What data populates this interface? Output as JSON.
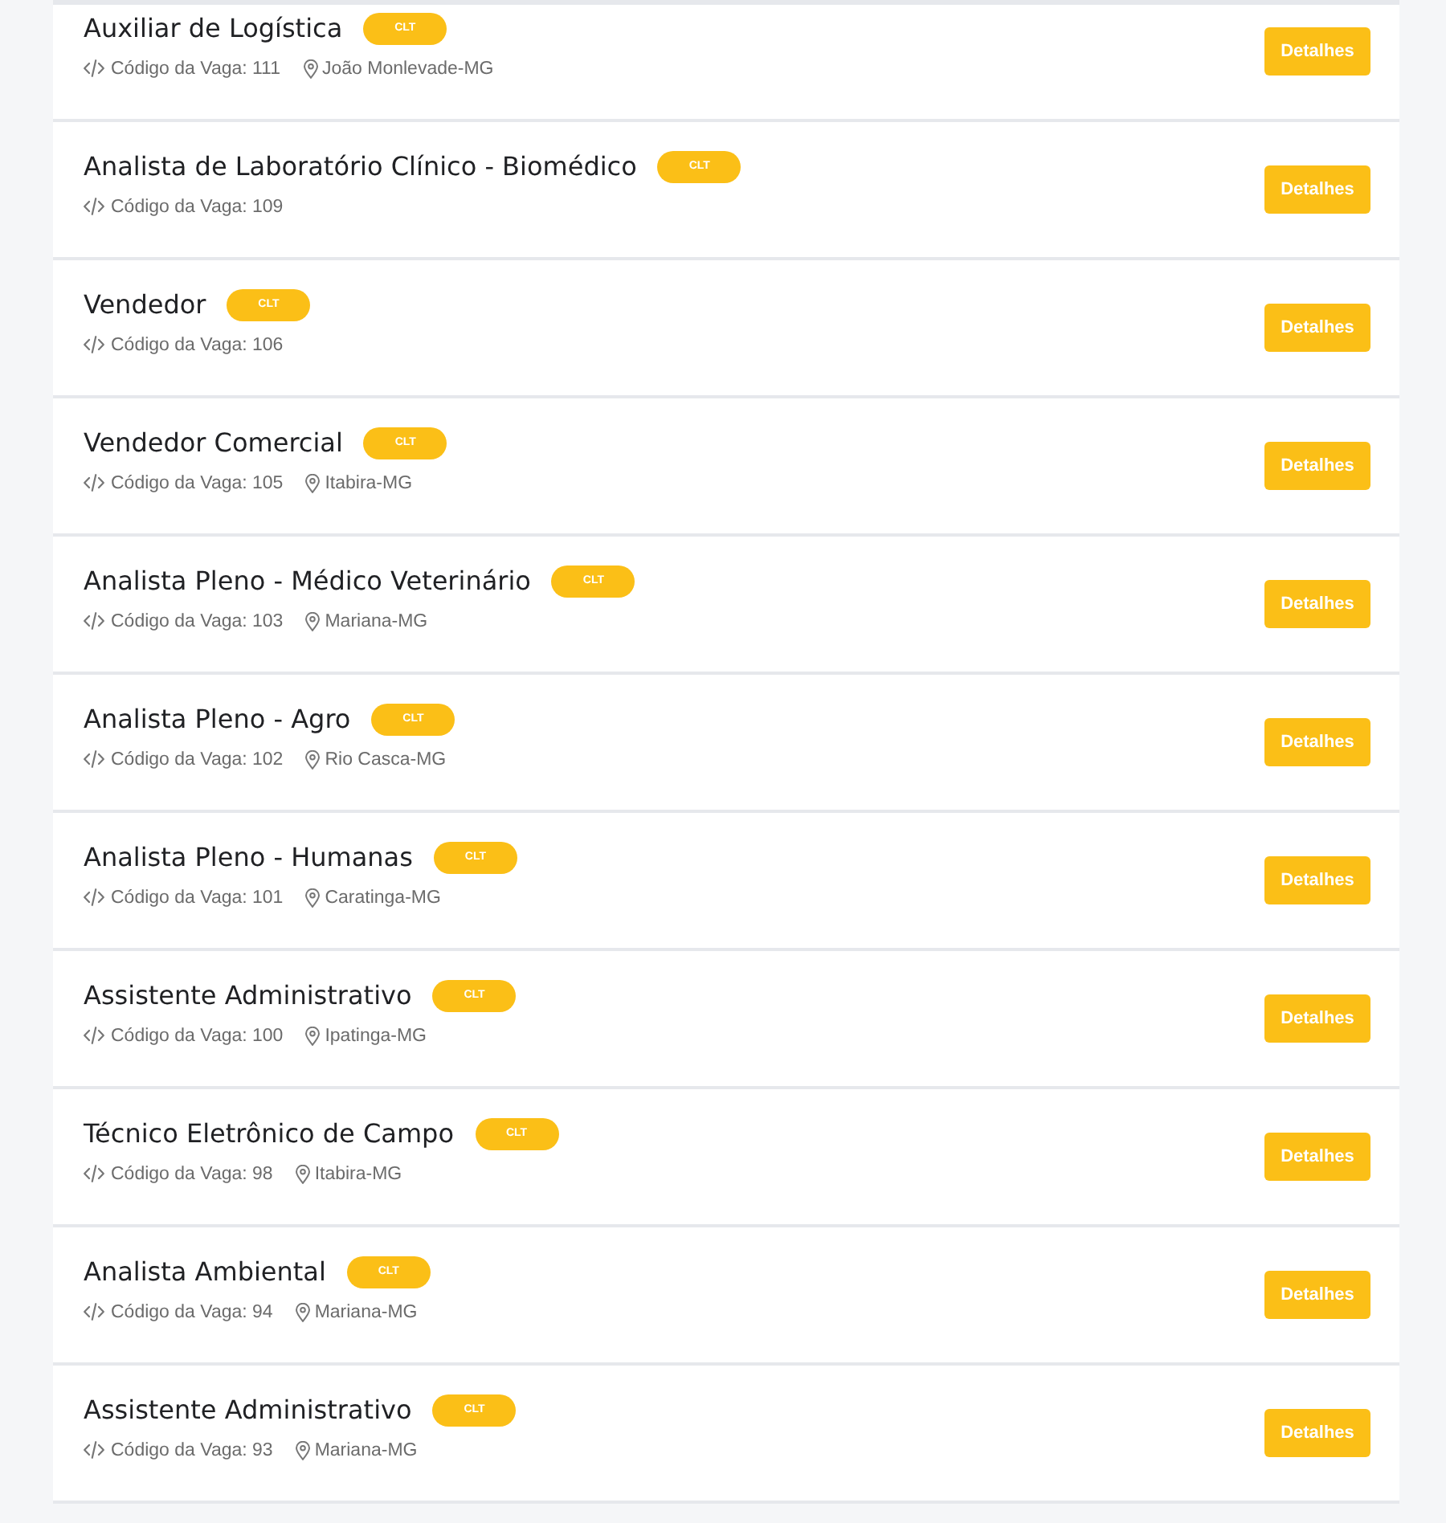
{
  "jobs": [
    {
      "title": "Auxiliar de Logística",
      "contract": "CLT",
      "code": "Código da Vaga: 111",
      "location": "João Monlevade-MG",
      "button": "Detalhes"
    },
    {
      "title": "Analista de Laboratório Clínico - Biomédico",
      "contract": "CLT",
      "code": "Código da Vaga: 109",
      "button": "Detalhes"
    },
    {
      "title": "Vendedor",
      "contract": "CLT",
      "code": "Código da Vaga: 106",
      "button": "Detalhes"
    },
    {
      "title": "Vendedor Comercial",
      "contract": "CLT",
      "code": "Código da Vaga: 105",
      "location": "Itabira-MG",
      "button": "Detalhes"
    },
    {
      "title": "Analista Pleno - Médico Veterinário",
      "contract": "CLT",
      "code": "Código da Vaga: 103",
      "location": "Mariana-MG",
      "button": "Detalhes"
    },
    {
      "title": "Analista Pleno - Agro",
      "contract": "CLT",
      "code": "Código da Vaga: 102",
      "location": "Rio Casca-MG",
      "button": "Detalhes"
    },
    {
      "title": "Analista Pleno - Humanas",
      "contract": "CLT",
      "code": "Código da Vaga: 101",
      "location": "Caratinga-MG",
      "button": "Detalhes"
    },
    {
      "title": "Assistente Administrativo",
      "contract": "CLT",
      "code": "Código da Vaga: 100",
      "location": "Ipatinga-MG",
      "button": "Detalhes"
    },
    {
      "title": "Técnico Eletrônico de Campo",
      "contract": "CLT",
      "code": "Código da Vaga: 98",
      "location": "Itabira-MG",
      "button": "Detalhes"
    },
    {
      "title": "Analista Ambiental",
      "contract": "CLT",
      "code": "Código da Vaga: 94",
      "location": "Mariana-MG",
      "button": "Detalhes"
    },
    {
      "title": "Assistente Administrativo",
      "contract": "CLT",
      "code": "Código da Vaga: 93",
      "location": "Mariana-MG",
      "button": "Detalhes"
    }
  ]
}
